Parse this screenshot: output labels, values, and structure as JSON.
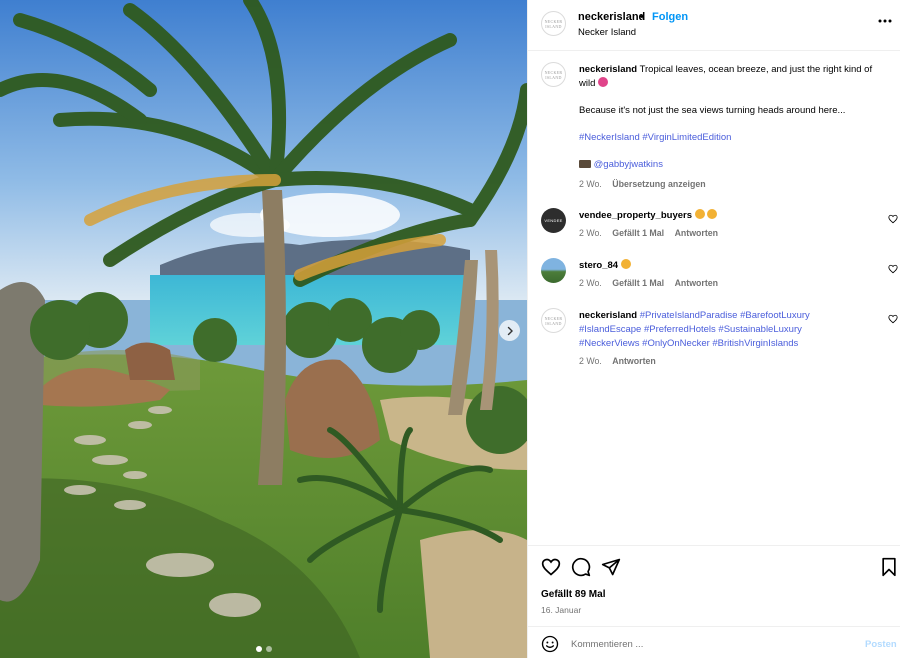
{
  "post": {
    "photo": {
      "alt_label": "",
      "next_icon": "chevron-right-icon",
      "carousel_dot_count": 2,
      "carousel_active_index": 0
    },
    "header": {
      "username": "neckerisland",
      "separator": "•",
      "follow_label": "Folgen",
      "location": "Necker Island",
      "more_icon": "more-horizontal-icon",
      "avatar_text": "NECKER ISLAND"
    },
    "caption": {
      "username": "neckerisland",
      "line1": "Tropical leaves, ocean breeze, and just the right kind of wild",
      "line2": "Because it's not just the sea views turning heads around here...",
      "hashtags": "#NeckerIsland #VirginLimitedEdition",
      "credit": "@gabbyjwatkins",
      "time": "2 Wo.",
      "translate": "Übersetzung anzeigen"
    },
    "comments": [
      {
        "username": "vendee_property_buyers",
        "text": "",
        "time": "2 Wo.",
        "likes": "Gefällt 1 Mal",
        "reply": "Antworten",
        "avatar_text": "VENDEE"
      },
      {
        "username": "stero_84",
        "text": "",
        "time": "2 Wo.",
        "likes": "Gefällt 1 Mal",
        "reply": "Antworten"
      },
      {
        "username": "neckerisland",
        "text": "#PrivateIslandParadise #BarefootLuxury #IslandEscape #PreferredHotels #SustainableLuxury #NeckerViews #OnlyOnNecker #BritishVirginIslands",
        "time": "2 Wo.",
        "reply": "Antworten",
        "avatar_text": "NECKER ISLAND"
      }
    ],
    "actions": {
      "like_icon": "heart-icon",
      "comment_icon": "comment-icon",
      "share_icon": "send-icon",
      "save_icon": "bookmark-icon",
      "likes": "Gefällt 89 Mal",
      "date": "16. Januar"
    },
    "comment_box": {
      "emoji_icon": "emoji-icon",
      "placeholder": "Kommentieren ...",
      "post_label": "Posten"
    },
    "colors": {
      "follow_blue": "#0095f6",
      "hashtag_blue": "#4a5ddb",
      "meta_gray": "#737373",
      "post_disabled": "#b3dbff"
    }
  }
}
